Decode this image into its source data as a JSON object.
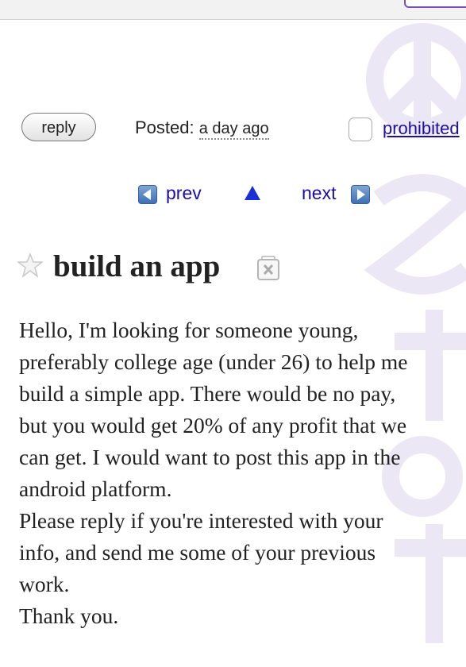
{
  "header": {
    "reply_label": "reply",
    "posted_label": "Posted:",
    "posted_time": "a day ago",
    "prohibited_label": "prohibited"
  },
  "nav": {
    "prev_label": "prev",
    "next_label": "next"
  },
  "post": {
    "title": "build an app",
    "body_lines": [
      "Hello, I'm looking for someone young,",
      "preferably college age (under 26) to help me",
      "build a simple app. There would be no pay,",
      "but you would get 20% of any profit that we",
      "can get. I would want to post this app in the",
      "android platform.",
      "Please reply if you're interested with your",
      "info, and send me some of your previous",
      "work.",
      "Thank you."
    ]
  },
  "icons": {
    "star": "star-icon",
    "trash": "trash-icon",
    "prev": "prev-arrow-icon",
    "next": "next-arrow-icon",
    "up": "up-arrow-icon"
  },
  "colors": {
    "link": "#1a0dab",
    "watermark": "#ece7f4",
    "nav_icon": "#4a78bd"
  }
}
